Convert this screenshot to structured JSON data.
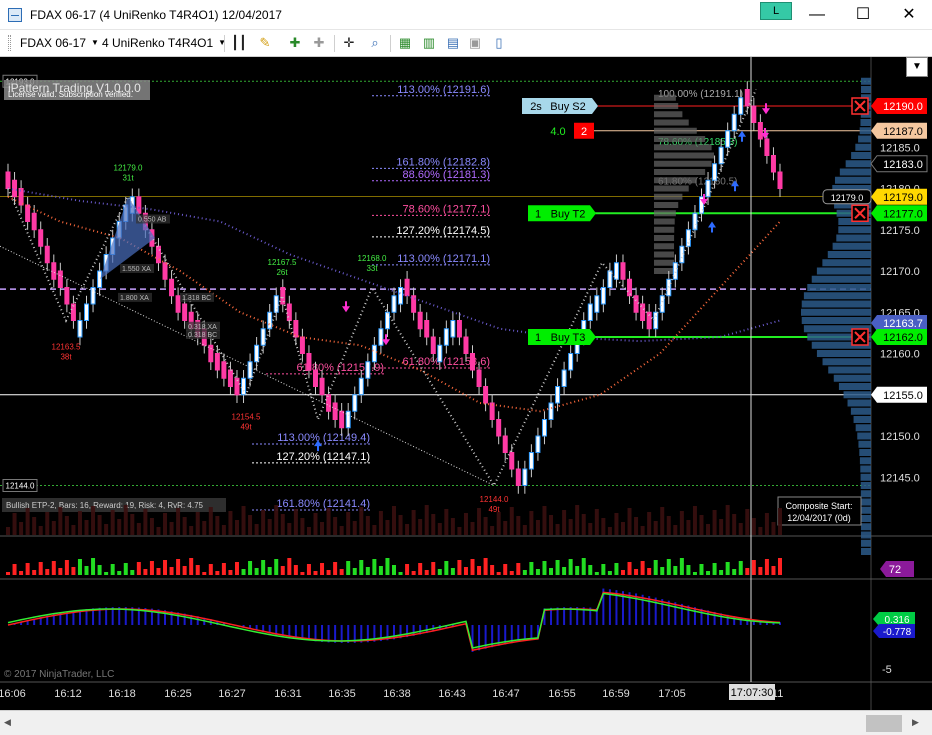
{
  "window": {
    "title": "FDAX 06-17 (4 UniRenko T4R4O1)  12/04/2017",
    "link_label": "L",
    "minimize": "—",
    "maximize": "☐",
    "close": "✕"
  },
  "toolbar": {
    "instrument": "FDAX 06-17",
    "bar_type": "4 UniRenko T4R4O1",
    "icons": [
      "bar-type-icon",
      "pencil-icon",
      "add-indicator-icon",
      "strategy-icon",
      "crosshair-icon",
      "zoom-icon",
      "data-box-icon",
      "chart-style-icon",
      "properties-icon",
      "save-icon",
      "layout-icon"
    ]
  },
  "chart_data": [
    {
      "type": "candlestick",
      "title": "FDAX 06-17 (4 UniRenko T4R4O1)",
      "watermark": "© 2017 NinjaTrader, LLC",
      "x_ticks": [
        "16:06",
        "16:12",
        "16:18",
        "16:25",
        "16:27",
        "16:31",
        "16:35",
        "16:38",
        "16:43",
        "16:47",
        "16:55",
        "16:59",
        "17:05",
        "17:11"
      ],
      "y_ticks": [
        12145.0,
        12150.0,
        12155.0,
        12160.0,
        12165.0,
        12170.0,
        12175.0,
        12180.0,
        12185.0
      ],
      "y_range": [
        12138,
        12194
      ],
      "cursor_time": "17:07:30",
      "price_markers": [
        {
          "label": "12193.0",
          "color": "#000000",
          "side": "left",
          "price": 12193.0
        },
        {
          "label": "12190.0",
          "color": "#ff0000",
          "side": "right",
          "price": 12190.0
        },
        {
          "label": "12187.0",
          "color": "#f4c79f",
          "side": "right",
          "price": 12187.0
        },
        {
          "label": "12183.0",
          "color": "#000000",
          "side": "right",
          "price": 12183.0
        },
        {
          "label": "12179.0",
          "color": "#ffd800",
          "side": "right",
          "price": 12179.0
        },
        {
          "label": "12177.0",
          "color": "#00ee00",
          "side": "right",
          "price": 12177.0
        },
        {
          "label": "12163.7",
          "color": "#4a5fc4",
          "side": "right",
          "price": 12163.7
        },
        {
          "label": "12162.0",
          "color": "#00ee00",
          "side": "right",
          "price": 12162.0
        },
        {
          "label": "12155.0",
          "color": "#ffffff",
          "side": "right",
          "price": 12155.0
        },
        {
          "label": "12144.0",
          "color": "#000000",
          "side": "left",
          "price": 12144.0
        }
      ],
      "current_price_label": "12179.0",
      "fib_levels": [
        {
          "label": "113.00% (12191.6)",
          "price": 12191.6,
          "color": "#8a8aff"
        },
        {
          "label": "100.00% (12191.1)",
          "price": 12191.1,
          "color": "#aaaaaa"
        },
        {
          "label": "161.80% (12182.8)",
          "price": 12182.8,
          "color": "#8a8aff"
        },
        {
          "label": "88.60% (12181.3)",
          "price": 12181.3,
          "color": "#b06bff"
        },
        {
          "label": "78.60% (12177.1)",
          "price": 12177.1,
          "color": "#ff4fa0"
        },
        {
          "label": "127.20% (12174.5)",
          "price": 12174.5,
          "color": "#ffffff"
        },
        {
          "label": "113.00% (12171.1)",
          "price": 12171.1,
          "color": "#8a8aff"
        },
        {
          "label": "78.60% (12185.3)",
          "price": 12185.3,
          "color": "#33dd66"
        },
        {
          "label": "61.80% (12180.5)",
          "price": 12180.5,
          "color": "#777777"
        },
        {
          "label": "61.80% (12157.9)",
          "price": 12157.9,
          "color": "#ff4fa0"
        },
        {
          "label": "61.80% (12158.6)",
          "price": 12158.6,
          "color": "#ff4fa0"
        },
        {
          "label": "113.00% (12149.4)",
          "price": 12149.4,
          "color": "#8a8aff"
        },
        {
          "label": "127.20% (12147.1)",
          "price": 12147.1,
          "color": "#ffffff"
        },
        {
          "label": "161.80% (12141.4)",
          "price": 12141.4,
          "color": "#8a8aff"
        }
      ],
      "swing_labels": [
        {
          "price": "12179.0",
          "ticks": "31t",
          "color": "#44ee44"
        },
        {
          "price": "12163.5",
          "ticks": "38t",
          "color": "#ff3333"
        },
        {
          "price": "12167.5",
          "ticks": "26t",
          "color": "#44ee44"
        },
        {
          "price": "12154.5",
          "ticks": "49t",
          "color": "#ff3333"
        },
        {
          "price": "12168.0",
          "ticks": "33t",
          "color": "#44ee44"
        },
        {
          "price": "12144.0",
          "ticks": "49t",
          "color": "#ff3333"
        }
      ],
      "pattern_labels": [
        "1.550 XA",
        "1.800 XA",
        "1.318 BC",
        "0.318 XA",
        "0.318 BC",
        "0.550 AB"
      ],
      "orders": [
        {
          "qty": "2s",
          "name": "Buy S2",
          "price": 12190.0,
          "color": "#a8d8ea"
        },
        {
          "qty": "4.0",
          "name": "2",
          "price": 12187.0,
          "color": "#ff0000"
        },
        {
          "qty": "1",
          "name": "Buy T2",
          "price": 12177.0,
          "color": "#00ee00"
        },
        {
          "qty": "1",
          "name": "Buy T3",
          "price": 12162.0,
          "color": "#00ee00"
        }
      ],
      "strategy_banner": "iPattern Trading V1.0.0.0",
      "license_text": "License valid. Subscription verified.",
      "pattern_info": "Bullish ETP-2, Bars: 16, Reward: 19, Risk: 4, RvR: 4.75",
      "composite_start_label": "Composite Start:",
      "composite_start_value": "12/04/2017 (0d)"
    },
    {
      "type": "bar",
      "title": "",
      "value_marker": "72",
      "marker_color": "#8b1a9a"
    },
    {
      "type": "line",
      "title": "",
      "y_ticks": [
        0,
        -5
      ],
      "value_markers": [
        {
          "label": "0.316",
          "color": "#00cc44"
        },
        {
          "label": "-0.778",
          "color": "#1a1acc"
        }
      ]
    }
  ]
}
